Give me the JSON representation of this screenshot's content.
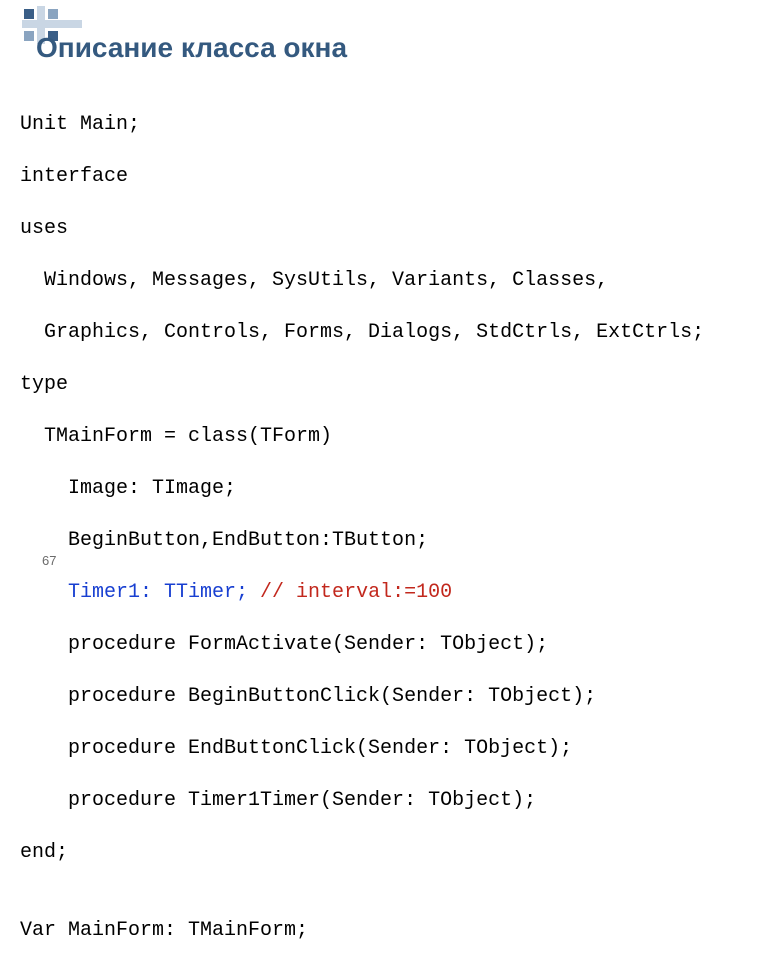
{
  "title": "Описание класса окна",
  "code": {
    "l1": "Unit Main;",
    "l2": "interface",
    "l3": "uses",
    "l4": "  Windows, Messages, SysUtils, Variants, Classes,",
    "l5": "  Graphics, Controls, Forms, Dialogs, StdCtrls, ExtCtrls;",
    "l6": "type",
    "l7": "  TMainForm = class(TForm)",
    "l8": "    Image: TImage;",
    "l9": "    BeginButton,EndButton:TButton;",
    "l10a": "    Timer1: TTimer;",
    "l10b": " // interval:=100",
    "l11": "    procedure FormActivate(Sender: TObject);",
    "l12": "    procedure BeginButtonClick(Sender: TObject);",
    "l13": "    procedure EndButtonClick(Sender: TObject);",
    "l14": "    procedure Timer1Timer(Sender: TObject);",
    "l15": "end;",
    "l16": "",
    "l17": "Var MainForm: TMainForm;"
  },
  "page_number": "67"
}
